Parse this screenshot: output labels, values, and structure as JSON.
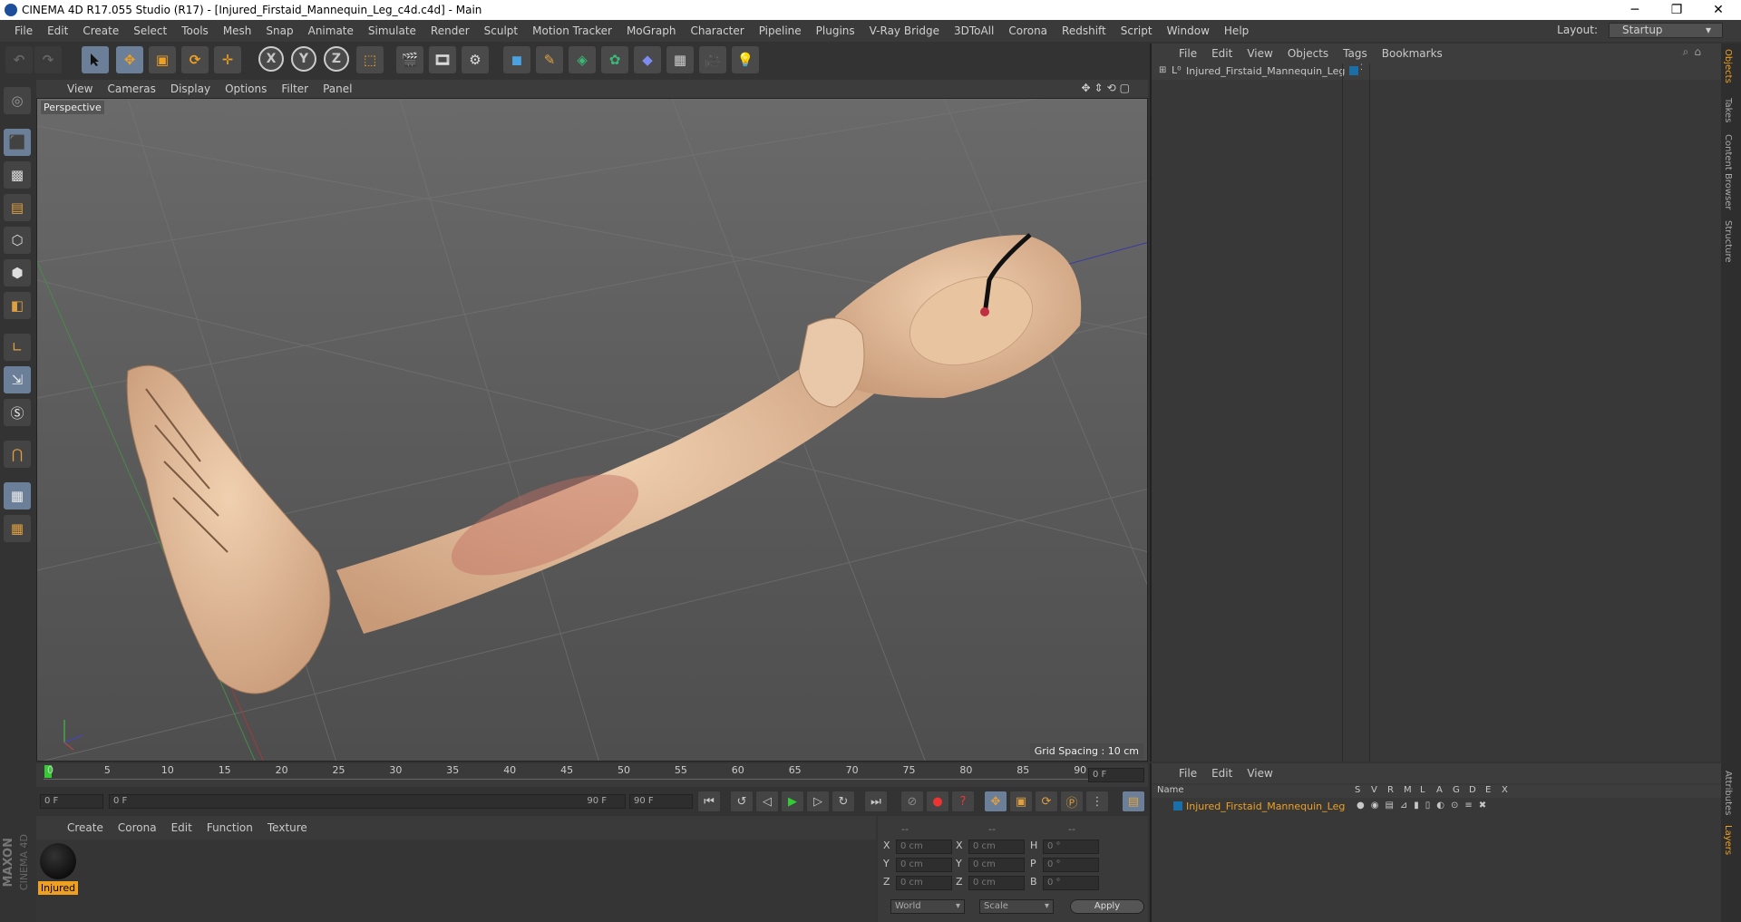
{
  "window": {
    "title": "CINEMA 4D R17.055 Studio (R17) - [Injured_Firstaid_Mannequin_Leg_c4d.c4d] - Main",
    "minimize": "─",
    "restore": "❐",
    "close": "✕"
  },
  "menubar": {
    "items": [
      "File",
      "Edit",
      "Create",
      "Select",
      "Tools",
      "Mesh",
      "Snap",
      "Animate",
      "Simulate",
      "Render",
      "Sculpt",
      "Motion Tracker",
      "MoGraph",
      "Character",
      "Pipeline",
      "Plugins",
      "V-Ray Bridge",
      "3DToAll",
      "Corona",
      "Redshift",
      "Script",
      "Window",
      "Help"
    ],
    "layout_label": "Layout:",
    "layout_value": "Startup"
  },
  "toolbar": {
    "x": "X",
    "y": "Y",
    "z": "Z"
  },
  "viewport": {
    "menu": [
      "View",
      "Cameras",
      "Display",
      "Options",
      "Filter",
      "Panel"
    ],
    "label": "Perspective",
    "grid_spacing": "Grid Spacing : 10 cm"
  },
  "timeline": {
    "ticks": [
      "0",
      "5",
      "10",
      "15",
      "20",
      "25",
      "30",
      "35",
      "40",
      "45",
      "50",
      "55",
      "60",
      "65",
      "70",
      "75",
      "80",
      "85",
      "90"
    ],
    "current_frame": "0 F",
    "start": "0 F",
    "range_start": "0 F",
    "range_end": "90 F",
    "end": "90 F"
  },
  "materials": {
    "menu": [
      "Create",
      "Corona",
      "Edit",
      "Function",
      "Texture"
    ],
    "item": "Injured"
  },
  "coords": {
    "headers": [
      "--",
      "--",
      "--"
    ],
    "rows": [
      {
        "a": "X",
        "av": "0 cm",
        "b": "X",
        "bv": "0 cm",
        "c": "H",
        "cv": "0 °"
      },
      {
        "a": "Y",
        "av": "0 cm",
        "b": "Y",
        "bv": "0 cm",
        "c": "P",
        "cv": "0 °"
      },
      {
        "a": "Z",
        "av": "0 cm",
        "b": "Z",
        "bv": "0 cm",
        "c": "B",
        "cv": "0 °"
      }
    ],
    "world": "World",
    "scale": "Scale",
    "apply": "Apply"
  },
  "objects": {
    "menu": [
      "File",
      "Edit",
      "View",
      "Objects",
      "Tags",
      "Bookmarks"
    ],
    "item": "Injured_Firstaid_Mannequin_Leg"
  },
  "layers": {
    "menu": [
      "File",
      "Edit",
      "View"
    ],
    "name_header": "Name",
    "cols": [
      "S",
      "V",
      "R",
      "M",
      "L",
      "A",
      "G",
      "D",
      "E",
      "X"
    ],
    "item": "Injured_Firstaid_Mannequin_Leg"
  },
  "sidetabs": {
    "right_top": [
      "Objects",
      "Takes",
      "Content Browser",
      "Structure"
    ],
    "right_bottom": [
      "Attributes",
      "Layers"
    ]
  },
  "brand": {
    "maxon": "MAXON",
    "c4d": "CINEMA 4D"
  },
  "colors": {
    "accent": "#e8a33a",
    "selected_layer": "#f0a020",
    "layer_color": "#1a6fa8"
  }
}
